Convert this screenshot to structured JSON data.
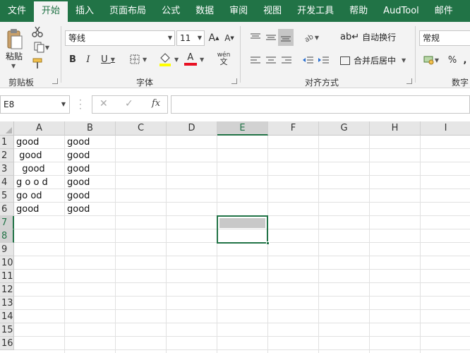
{
  "menu": {
    "tabs": [
      "文件",
      "开始",
      "插入",
      "页面布局",
      "公式",
      "数据",
      "审阅",
      "视图",
      "开发工具",
      "帮助",
      "AudTool",
      "邮件"
    ],
    "active_index": 1
  },
  "ribbon": {
    "clipboard": {
      "label": "剪贴板",
      "paste_label": "粘贴"
    },
    "font": {
      "label": "字体",
      "font_name": "等线",
      "font_size": "11",
      "bold": "B",
      "italic": "I",
      "underline": "U",
      "grow": "A",
      "shrink": "A",
      "wen_top": "wén",
      "wen_bottom": "文",
      "font_color_letter": "A"
    },
    "alignment": {
      "label": "对齐方式",
      "wrap_text": "自动换行",
      "merge_center": "合并后居中"
    },
    "number": {
      "label": "数字",
      "format": "常规",
      "percent": "%",
      "comma": ","
    }
  },
  "formula_bar": {
    "name_box": "E8",
    "cancel": "✕",
    "enter": "✓",
    "fx": "fx",
    "content": ""
  },
  "grid": {
    "columns": [
      "A",
      "B",
      "C",
      "D",
      "E",
      "F",
      "G",
      "H",
      "I"
    ],
    "rows": [
      "1",
      "2",
      "3",
      "4",
      "5",
      "6",
      "7",
      "8",
      "9",
      "10",
      "11",
      "12",
      "13",
      "14",
      "15",
      "16"
    ],
    "selected_column": "E",
    "selected_rows": [
      "7",
      "8"
    ],
    "cells": [
      {
        "ref": "A1",
        "value": "good"
      },
      {
        "ref": "A2",
        "value": " good"
      },
      {
        "ref": "A3",
        "value": "  good"
      },
      {
        "ref": "A4",
        "value": "g o o d"
      },
      {
        "ref": "A5",
        "value": "go od"
      },
      {
        "ref": "A6",
        "value": "good"
      },
      {
        "ref": "B1",
        "value": "good"
      },
      {
        "ref": "B2",
        "value": "good"
      },
      {
        "ref": "B3",
        "value": "good"
      },
      {
        "ref": "B4",
        "value": "good"
      },
      {
        "ref": "B5",
        "value": "good"
      },
      {
        "ref": "B6",
        "value": "good"
      }
    ]
  },
  "colors": {
    "accent": "#217346",
    "ribbon_bg": "#f3f3f3",
    "header_bg": "#e6e6e6",
    "selected_header": "#d2d2d2",
    "selection_fill": "#c8c8c8",
    "font_color_bar": "#e81123",
    "fill_color_bar": "#ffff00"
  },
  "icons": [
    "scissors-icon",
    "copy-icon",
    "format-painter-icon",
    "paste-icon",
    "bold-icon",
    "italic-icon",
    "underline-icon",
    "border-icon",
    "fill-color-icon",
    "font-color-icon",
    "phonetic-icon",
    "align-top-icon",
    "align-middle-icon",
    "align-bottom-icon",
    "orientation-icon",
    "align-left-icon",
    "align-center-icon",
    "align-right-icon",
    "decrease-indent-icon",
    "increase-indent-icon",
    "wrap-text-icon",
    "merge-icon",
    "currency-icon",
    "percent-icon",
    "comma-icon",
    "dialog-launcher-icon"
  ]
}
